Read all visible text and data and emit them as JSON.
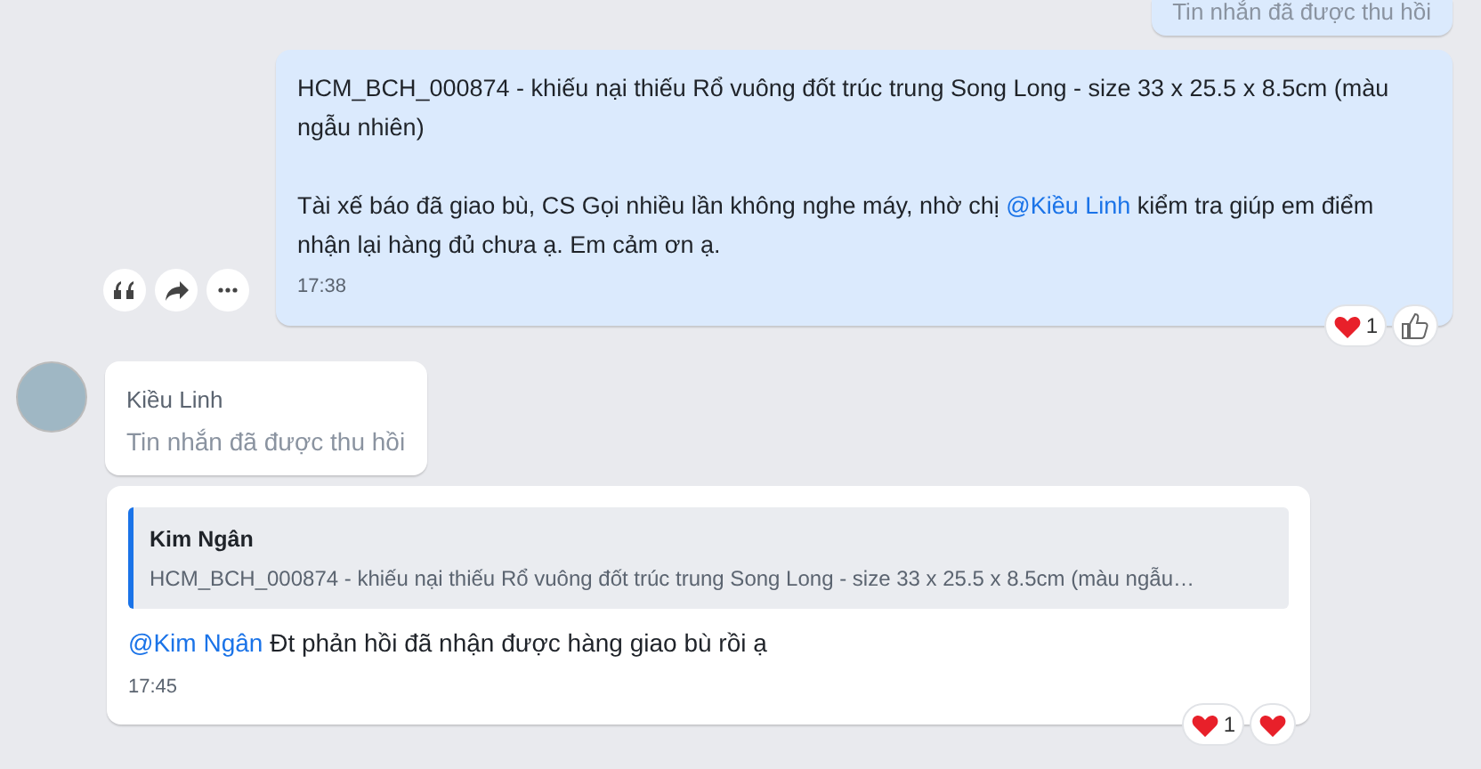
{
  "top_recalled": {
    "text": "Tin nhắn đã được thu hồi"
  },
  "outgoing": {
    "paragraphs": [
      [
        {
          "text": "HCM_BCH_000874 - khiếu nại thiếu Rổ vuông đốt trúc trung Song Long - size 33 x 25.5 x 8.5cm (màu ngẫu nhiên)",
          "mention": false
        }
      ],
      [
        {
          "text": "Tài xế báo đã giao bù, CS Gọi nhiều lần không nghe máy, nhờ chị ",
          "mention": false
        },
        {
          "text": "@Kiều Linh",
          "mention": true
        },
        {
          "text": " kiểm tra giúp em điểm nhận lại hàng đủ chưa ạ. Em cảm ơn ạ.",
          "mention": false
        }
      ]
    ],
    "time": "17:38",
    "actions": [
      {
        "kind": "quote"
      },
      {
        "kind": "forward"
      },
      {
        "kind": "more"
      }
    ],
    "reactions": [
      {
        "kind": "heart",
        "count": "1"
      },
      {
        "kind": "like"
      }
    ]
  },
  "incoming_recalled": {
    "sender": "Kiều Linh",
    "text": "Tin nhắn đã được thu hồi"
  },
  "reply": {
    "quote": {
      "author": "Kim Ngân",
      "text": "HCM_BCH_000874 - khiếu nại thiếu Rổ vuông đốt trúc trung Song Long - size 33 x 25.5 x 8.5cm (màu ngẫu…"
    },
    "parts": [
      {
        "text": "@Kim Ngân",
        "mention": true
      },
      {
        "text": " Đt phản hồi đã nhận được hàng giao bù rồi ạ",
        "mention": false
      }
    ],
    "time": "17:45",
    "reactions": [
      {
        "kind": "heart",
        "count": "1"
      },
      {
        "kind": "heart"
      }
    ]
  }
}
